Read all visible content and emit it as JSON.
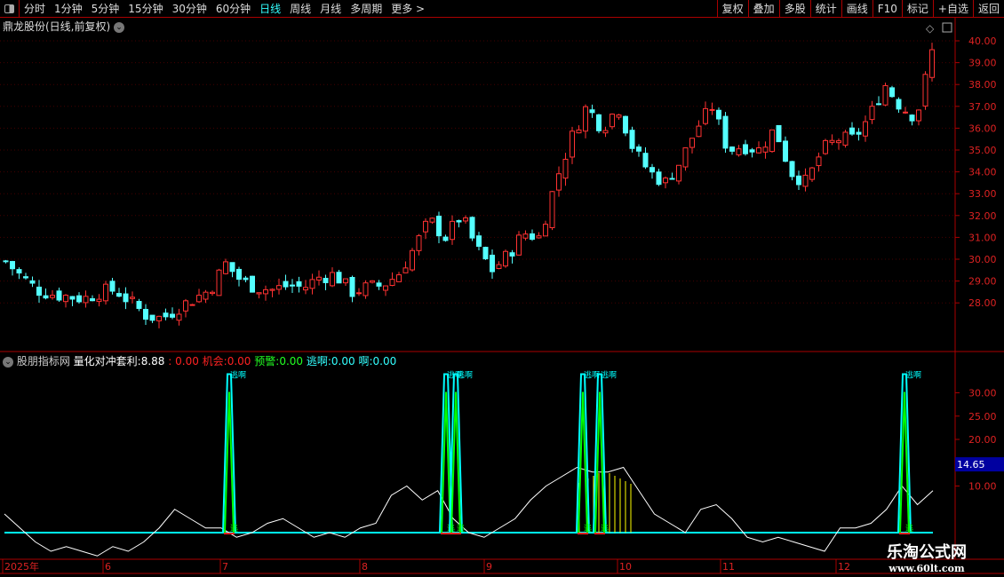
{
  "toolbar": {
    "periods": [
      "分时",
      "1分钟",
      "5分钟",
      "15分钟",
      "30分钟",
      "60分钟",
      "日线",
      "周线",
      "月线",
      "多周期",
      "更多 >"
    ],
    "active": "日线",
    "right": [
      "复权",
      "叠加",
      "多股",
      "统计",
      "画线",
      "F10",
      "标记",
      "+自选",
      "返回"
    ]
  },
  "title": "鼎龙股份(日线,前复权)",
  "price_axis": [
    "40.00",
    "39.00",
    "38.00",
    "37.00",
    "36.00",
    "35.00",
    "34.00",
    "33.00",
    "32.00",
    "31.00",
    "30.00",
    "29.00",
    "28.00"
  ],
  "indicator": {
    "name": "股朋指标网",
    "label": "量化对冲套利:",
    "value": "8.88",
    "f1": ": 0.00",
    "f2_label": "机会:",
    "f2": "0.00",
    "f3_label": "预警:",
    "f3": "0.00",
    "f4_label": "逃啊:",
    "f4": "0.00",
    "f5_label": "啊:",
    "f5": "0.00",
    "axis": [
      "30.00",
      "25.00",
      "20.00",
      "15.00",
      "10.00"
    ],
    "current": "14.65",
    "top_label": "逃啊",
    "bottom_label": "逃"
  },
  "date_axis": [
    "2025年",
    "6",
    "7",
    "8",
    "9",
    "10",
    "11",
    "12"
  ],
  "watermark": {
    "name": "乐淘公式网",
    "url": "www.60lt.com"
  },
  "colors": {
    "up": "#ff3232",
    "down": "#54ffff",
    "line": "#ffffff",
    "cyan": "#00ffff",
    "green": "#00ff00",
    "yellow": "#ffff00"
  },
  "chart_data": {
    "type": "candlestick",
    "closes_keypoints": [
      29.9,
      29.2,
      28.6,
      28.4,
      28.3,
      28.2,
      28.5,
      28.6,
      28.0,
      27.4,
      27.3,
      27.8,
      28.2,
      28.6,
      29.8,
      29.0,
      28.7,
      28.6,
      28.8,
      28.7,
      29.2,
      29.3,
      28.5,
      28.7,
      28.8,
      29.3,
      30.5,
      31.8,
      31.0,
      32.0,
      30.5,
      29.5,
      30.2,
      31.2,
      31.0,
      33.5,
      35.5,
      37.0,
      36.0,
      37.0,
      35.0,
      34.0,
      33.5,
      34.5,
      36.0,
      37.0,
      35.0,
      35.2,
      35.0,
      36.0,
      34.0,
      33.5,
      35.0,
      35.5,
      35.5,
      36.5,
      38.0,
      37.0,
      36.5,
      39.5
    ],
    "indicator_line_keypoints": [
      4,
      1,
      -2,
      -4,
      -3,
      -4,
      -5,
      -3,
      -4,
      -2,
      1,
      5,
      3,
      1,
      1,
      -1,
      0,
      2,
      3,
      1,
      -1,
      0,
      -1,
      1,
      2,
      8,
      10,
      7,
      9,
      3,
      0,
      -1,
      1,
      3,
      7,
      10,
      12,
      14,
      13,
      13,
      14,
      9,
      4,
      2,
      0,
      5,
      6,
      3,
      -1,
      -2,
      -1,
      -2,
      -3,
      -4,
      1,
      1,
      2,
      5,
      10,
      6,
      9
    ],
    "spikes": [
      34,
      34,
      34,
      34,
      34,
      34
    ]
  }
}
